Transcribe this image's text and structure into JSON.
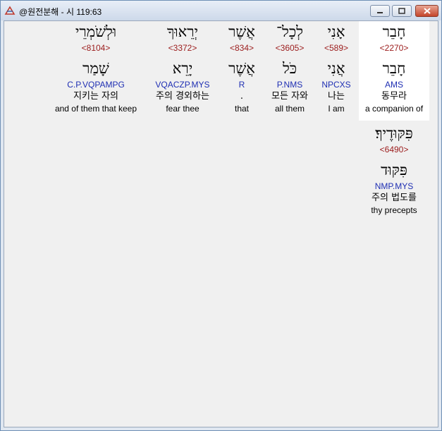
{
  "window": {
    "title": "@원전분해 - 시 119:63"
  },
  "words": [
    {
      "hebrew": "חָבֵר",
      "strong": "<2270>",
      "lemma": "חָבֵר",
      "parse": "AMS",
      "korean": "동무라",
      "english": "a companion of",
      "selected": true
    },
    {
      "hebrew": "אָנִי",
      "strong": "<589>",
      "lemma": "אֲנִי",
      "parse": "NPCXS",
      "korean": "나는",
      "english": "I am",
      "selected": false
    },
    {
      "hebrew": "לְכָל־",
      "strong": "<3605>",
      "lemma": "כֹּל",
      "parse": "P.NMS",
      "korean": "모든 자와",
      "english": "all them",
      "selected": false
    },
    {
      "hebrew": "אֲשֶׁר",
      "strong": "<834>",
      "lemma": "אֲשֶׁר",
      "parse": "R",
      "korean": ".",
      "english": "that",
      "selected": false
    },
    {
      "hebrew": "יְרֵאוּךָ",
      "strong": "<3372>",
      "lemma": "יָרֵא",
      "parse": "VQACZP.MYS",
      "korean": "주의 경외하는",
      "english": "fear thee",
      "selected": false
    },
    {
      "hebrew": "וּלְשֹׁמְרֵי",
      "strong": "<8104>",
      "lemma": "שָׁמַר",
      "parse": "C.P.VQPAMPG",
      "korean": "지키는 자의",
      "english": "and of them that keep",
      "selected": false
    },
    {
      "hebrew": "פִּקּוּדֶיךָ׃",
      "strong": "<6490>",
      "lemma": "פִּקּוּד",
      "parse": "NMP.MYS",
      "korean": "주의 법도를",
      "english": "thy precepts",
      "selected": false
    }
  ]
}
